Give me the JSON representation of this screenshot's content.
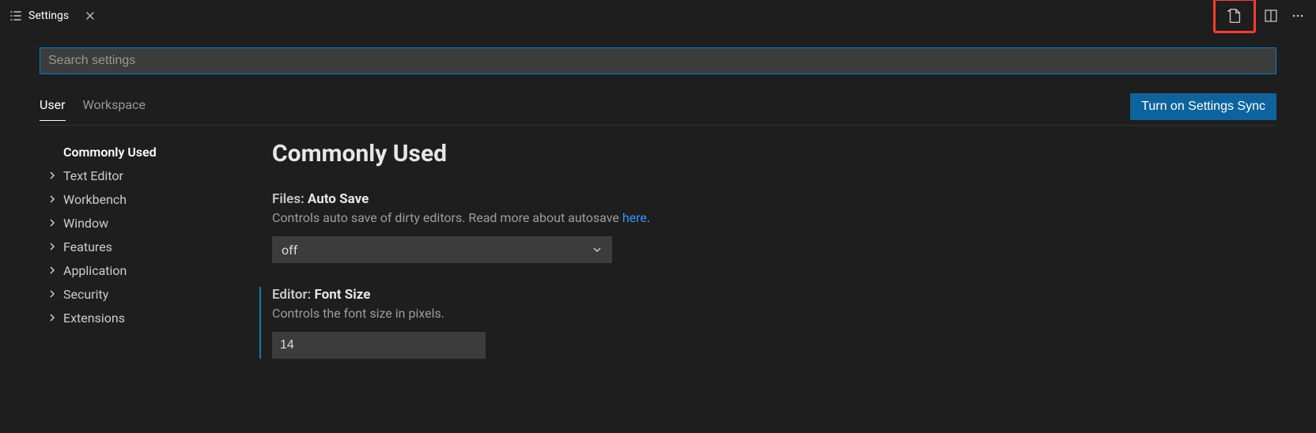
{
  "tab": {
    "title": "Settings"
  },
  "search": {
    "placeholder": "Search settings"
  },
  "scope": {
    "user": "User",
    "workspace": "Workspace"
  },
  "syncButton": "Turn on Settings Sync",
  "toc": {
    "items": [
      {
        "label": "Commonly Used",
        "active": true,
        "expandable": false
      },
      {
        "label": "Text Editor",
        "active": false,
        "expandable": true
      },
      {
        "label": "Workbench",
        "active": false,
        "expandable": true
      },
      {
        "label": "Window",
        "active": false,
        "expandable": true
      },
      {
        "label": "Features",
        "active": false,
        "expandable": true
      },
      {
        "label": "Application",
        "active": false,
        "expandable": true
      },
      {
        "label": "Security",
        "active": false,
        "expandable": true
      },
      {
        "label": "Extensions",
        "active": false,
        "expandable": true
      }
    ]
  },
  "section": {
    "title": "Commonly Used"
  },
  "settings": {
    "autoSave": {
      "category": "Files:",
      "name": "Auto Save",
      "descPrefix": "Controls auto save of dirty editors. Read more about autosave ",
      "linkText": "here",
      "descSuffix": ".",
      "value": "off"
    },
    "fontSize": {
      "category": "Editor:",
      "name": "Font Size",
      "desc": "Controls the font size in pixels.",
      "value": "14"
    }
  }
}
